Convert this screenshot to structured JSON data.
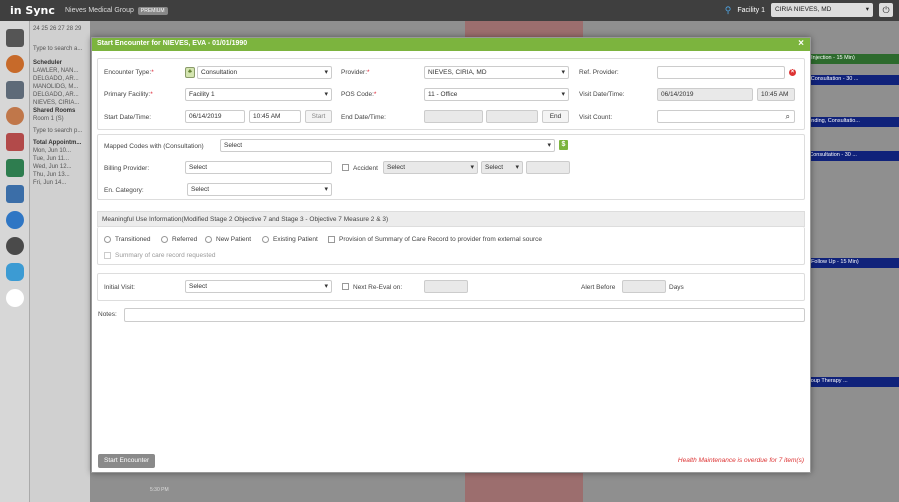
{
  "topbar": {
    "logo": "in Sync",
    "org": "Nieves Medical Group",
    "org_badge": "PREMIUM",
    "facility": "Facility 1",
    "provider": "CIRIA NIEVES, MD"
  },
  "left_panel": {
    "dates_top": "24 25 26 27 28 29",
    "search_placeholder": "Type to search a...",
    "scheduler_label": "Scheduler",
    "scheduler_items": [
      "LAWLER, NAN...",
      "DELGADO, AR...",
      "MANOLIDG, M...",
      "DELGADO, AR...",
      "NIEVES, CIRIA..."
    ],
    "shared_rooms": "Shared Rooms",
    "room": "Room 1 (S)",
    "search2_placeholder": "Type to search p...",
    "total_appts": "Total Appointm...",
    "day_items": [
      "Mon, Jun 10...",
      "Tue, Jun 11...",
      "Wed, Jun 12...",
      "Thu, Jun 13...",
      "Fri, Jun 14..."
    ]
  },
  "calendar": {
    "events": [
      "(Pending, Injection - 15 Min)",
      "Check In, Consultation - 30 ...",
      "TROY (Pending, Consultatio...",
      "Pending, Consultation - 30 ...",
      "(Pending, Follow Up - 15 Min)",
      "Group (Group Therapy ..."
    ],
    "time_label": "5:30 PM"
  },
  "dialog": {
    "title": "Start Encounter for NIEVES, EVA - 01/01/1990",
    "encounter_type_label": "Encounter Type:",
    "encounter_type_value": "Consultation",
    "provider_label": "Provider:",
    "provider_value": "NIEVES, CIRIA, MD",
    "ref_provider_label": "Ref. Provider:",
    "primary_facility_label": "Primary Facility:",
    "primary_facility_value": "Facility 1",
    "pos_code_label": "POS Code:",
    "pos_code_value": "11 - Office",
    "visit_datetime_label": "Visit Date/Time:",
    "visit_date_value": "06/14/2019",
    "visit_time_value": "10:45 AM",
    "start_datetime_label": "Start Date/Time:",
    "start_date_value": "06/14/2019",
    "start_time_value": "10:45 AM",
    "start_button": "Start",
    "end_datetime_label": "End Date/Time:",
    "end_button": "End",
    "visit_count_label": "Visit Count:",
    "mapped_codes_label": "Mapped Codes with (Consultation)",
    "mapped_codes_value": "Select",
    "billing_provider_label": "Billing Provider:",
    "billing_provider_value": "Select",
    "accident_label": "Accident",
    "accident_select1": "Select",
    "accident_select2": "Select",
    "en_category_label": "En. Category:",
    "en_category_value": "Select",
    "mu_header": "Meaningful Use Information(Modified Stage 2 Objective 7 and Stage 3 - Objective 7 Measure 2 & 3)",
    "mu_options": [
      "Transitioned",
      "Referred",
      "New Patient",
      "Existing Patient"
    ],
    "provision_label": "Provision of Summary of Care Record to provider from external source",
    "summary_requested_label": "Summary of care record requested",
    "initial_visit_label": "Initial Visit:",
    "initial_visit_value": "Select",
    "next_reeval_label": "Next Re-Eval on:",
    "alert_before_label": "Alert Before",
    "days_label": "Days",
    "notes_label": "Notes:",
    "start_encounter_button": "Start Encounter",
    "warning": "Health Maintenance is overdue for 7 item(s)"
  },
  "colors": {
    "title_green": "#7cb43e",
    "event_blue": "#10227a",
    "warning_red": "#d33333"
  }
}
